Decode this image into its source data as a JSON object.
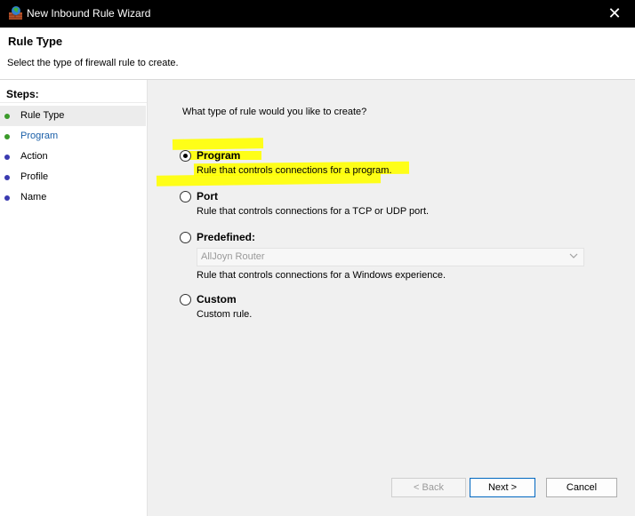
{
  "window": {
    "title": "New Inbound Rule Wizard",
    "close_glyph": "✕"
  },
  "header": {
    "title": "Rule Type",
    "subtitle": "Select the type of firewall rule to create."
  },
  "steps": {
    "label": "Steps:",
    "items": [
      {
        "label": "Rule Type",
        "status": "green"
      },
      {
        "label": "Program",
        "status": "green"
      },
      {
        "label": "Action",
        "status": "blue"
      },
      {
        "label": "Profile",
        "status": "blue"
      },
      {
        "label": "Name",
        "status": "blue"
      }
    ]
  },
  "main": {
    "question": "What type of rule would you like to create?",
    "options": [
      {
        "title": "Program",
        "description": "Rule that controls connections for a program.",
        "selected": true
      },
      {
        "title": "Port",
        "description": "Rule that controls connections for a TCP or UDP port.",
        "selected": false
      },
      {
        "title": "Predefined:",
        "description": "Rule that controls connections for a Windows experience.",
        "selected": false
      },
      {
        "title": "Custom",
        "description": "Custom rule.",
        "selected": false
      }
    ],
    "predefined_dropdown": {
      "value": "AllJoyn Router",
      "enabled": false
    }
  },
  "buttons": {
    "back": "< Back",
    "next": "Next >",
    "cancel": "Cancel"
  },
  "colors": {
    "highlight": "#ffff00",
    "step_complete": "#3a9a2a",
    "step_pending": "#3a3ab0",
    "link": "#1a5fa8"
  }
}
